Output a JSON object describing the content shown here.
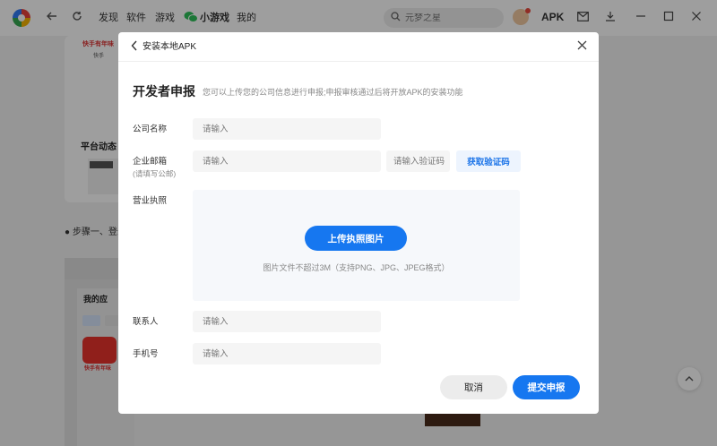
{
  "topbar": {
    "nav": [
      {
        "label": "发现"
      },
      {
        "label": "软件"
      },
      {
        "label": "游戏"
      },
      {
        "label": "小游戏"
      },
      {
        "label": "我的"
      }
    ],
    "search_placeholder": "元梦之星",
    "apk_label": "APK",
    "icons": [
      "app-logo-icon",
      "back-arrow-icon",
      "refresh-icon",
      "wechat-icon",
      "search-icon",
      "avatar",
      "mail-icon",
      "download-icon",
      "minimize-icon",
      "maximize-icon",
      "close-icon"
    ]
  },
  "background": {
    "thumb_title": "快手有年味",
    "thumb_sub": "快手",
    "platform_label": "平台动态",
    "step_text": "● 步骤一、登录",
    "myapp_label": "我的应",
    "app_name": "快手有年味"
  },
  "modal": {
    "title": "安装本地APK",
    "heading": "开发者申报",
    "subheading": "您可以上传您的公司信息进行申报;申报审核通过后将开放APK的安装功能",
    "company": {
      "label": "公司名称",
      "placeholder": "请输入"
    },
    "email": {
      "label": "企业邮箱",
      "sublabel": "(请填写公邮)",
      "placeholder": "请输入",
      "code_placeholder": "请输入验证码",
      "code_button": "获取验证码"
    },
    "license": {
      "label": "营业执照",
      "upload_button": "上传执照图片",
      "hint": "图片文件不超过3M（支持PNG、JPG、JPEG格式）"
    },
    "contact": {
      "label": "联系人",
      "placeholder": "请输入"
    },
    "phone": {
      "label": "手机号",
      "placeholder": "请输入"
    },
    "cancel_label": "取消",
    "submit_label": "提交申报"
  },
  "colors": {
    "accent": "#1677f0",
    "overlay": "rgba(0,0,0,0.38)"
  }
}
